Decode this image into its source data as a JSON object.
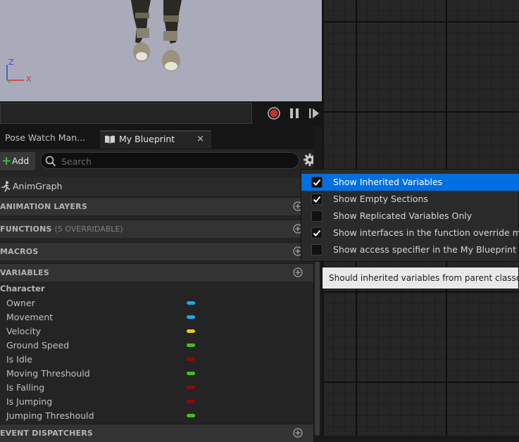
{
  "viewport": {
    "axis_z": "Z",
    "axis_x": "X",
    "colors": {
      "background": "#a9abbb",
      "axis_z": "#3a4ad6",
      "axis_x": "#d83030",
      "axis_y": "#3fbf3f"
    }
  },
  "playback": {
    "icons": [
      "record-icon",
      "pause-icon",
      "step-forward-icon"
    ],
    "record_color": "#c0342b"
  },
  "tabs": [
    {
      "label": "Pose Watch Man...",
      "active": false
    },
    {
      "label": "My Blueprint",
      "active": true,
      "icon": "book-icon",
      "close": "×"
    }
  ],
  "toolbar": {
    "add_label": "Add",
    "search_placeholder": "Search",
    "settings_icon": "gear-icon"
  },
  "anim_graph": {
    "label": "AnimGraph",
    "icon": "running-figure-icon"
  },
  "sections": {
    "animation_layers": "ANIMATION LAYERS",
    "functions": "FUNCTIONS",
    "functions_sub": "(5 OVERRIDABLE)",
    "macros": "MACROS",
    "variables": "VARIABLES",
    "event_dispatchers": "EVENT DISPATCHERS"
  },
  "variables": {
    "category": "Character",
    "items": [
      {
        "name": "Owner",
        "color": "#1ea8e6"
      },
      {
        "name": "Movement",
        "color": "#1ea8e6"
      },
      {
        "name": "Velocity",
        "color": "#f5c518"
      },
      {
        "name": "Ground Speed",
        "color": "#42c21e"
      },
      {
        "name": "Is Idle",
        "color": "#8b0a0a"
      },
      {
        "name": "Moving Threshould",
        "color": "#42c21e"
      },
      {
        "name": "Is Falling",
        "color": "#8b0a0a"
      },
      {
        "name": "Is Jumping",
        "color": "#8b0a0a"
      },
      {
        "name": "Jumping Threshould",
        "color": "#42c21e"
      }
    ]
  },
  "settings_menu": {
    "items": [
      {
        "label": "Show Inherited Variables",
        "checked": true,
        "highlighted": true
      },
      {
        "label": "Show Empty Sections",
        "checked": true,
        "highlighted": false
      },
      {
        "label": "Show Replicated Variables Only",
        "checked": false,
        "highlighted": false
      },
      {
        "label": "Show interfaces in the function override menu",
        "checked": true,
        "highlighted": false
      },
      {
        "label": "Show access specifier in the My Blueprint View",
        "checked": false,
        "highlighted": false
      }
    ],
    "highlight_color": "#0070e0"
  },
  "tooltip": "Should inherited variables from parent classes and"
}
